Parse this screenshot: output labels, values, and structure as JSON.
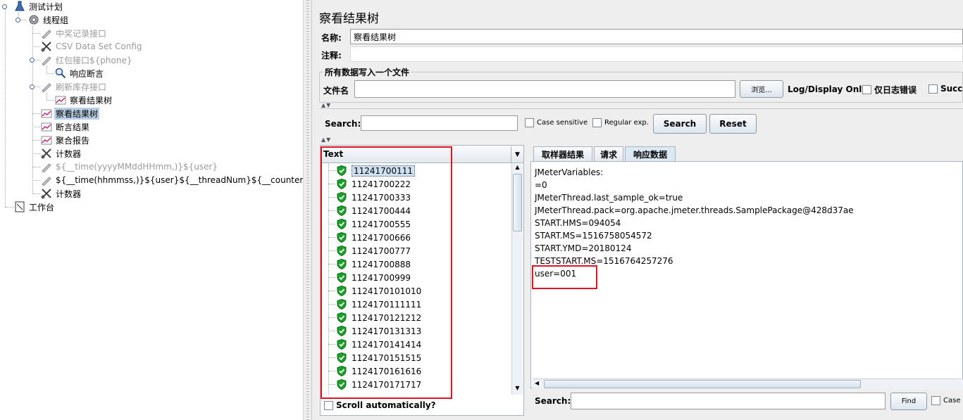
{
  "tree": {
    "items": [
      {
        "label": "测试计划",
        "icon": "test-plan-icon",
        "disabled": false,
        "selected": false
      },
      {
        "label": "线程组",
        "icon": "gear-icon",
        "disabled": false,
        "selected": false
      },
      {
        "label": "中奖记录接口",
        "icon": "sampler-pen-icon",
        "disabled": true,
        "selected": false
      },
      {
        "label": "CSV Data Set Config",
        "icon": "config-scissors-icon",
        "disabled": true,
        "selected": false
      },
      {
        "label": "红包接口${phone}",
        "icon": "sampler-pen-icon",
        "disabled": true,
        "selected": false
      },
      {
        "label": "响应断言",
        "icon": "magnifier-icon",
        "disabled": false,
        "selected": false
      },
      {
        "label": "刷新库存接口",
        "icon": "sampler-pen-icon",
        "disabled": true,
        "selected": false
      },
      {
        "label": "察看结果树",
        "icon": "listener-chart-icon",
        "disabled": false,
        "selected": false
      },
      {
        "label": "察看结果树",
        "icon": "listener-chart-icon",
        "disabled": false,
        "selected": true
      },
      {
        "label": "断言结果",
        "icon": "listener-chart-icon",
        "disabled": false,
        "selected": false
      },
      {
        "label": "聚合报告",
        "icon": "listener-chart-icon",
        "disabled": false,
        "selected": false
      },
      {
        "label": "计数器",
        "icon": "config-scissors-icon",
        "disabled": false,
        "selected": false
      },
      {
        "label": "${__time(yyyyMMddHHmm,)}${user}",
        "icon": "sampler-pen-icon",
        "disabled": true,
        "selected": false
      },
      {
        "label": "${__time(hhmmss,)}${user}${__threadNum}${__counter(,)}",
        "icon": "sampler-pen-icon",
        "disabled": false,
        "selected": false
      },
      {
        "label": "计数器",
        "icon": "config-scissors-icon",
        "disabled": false,
        "selected": false
      },
      {
        "label": "工作台",
        "icon": "workbench-icon",
        "disabled": false,
        "selected": false
      }
    ]
  },
  "panel": {
    "title": "察看结果树",
    "name_label": "名称:",
    "name_value": "察看结果树",
    "comment_label": "注释:",
    "comment_value": "",
    "file_group_title": "所有数据写入一个文件",
    "file_label": "文件名",
    "file_value": "",
    "browse_label": "浏览...",
    "log_display_label": "Log/Display Only:",
    "errors_only_label": "仅日志错误",
    "successes_label": "Succe"
  },
  "search": {
    "label": "Search:",
    "value": "",
    "case_sensitive_label": "Case sensitive",
    "regex_label": "Regular exp.",
    "search_button": "Search",
    "reset_button": "Reset"
  },
  "results": {
    "renderer": "Text",
    "items": [
      "11241700111",
      "11241700222",
      "11241700333",
      "11241700444",
      "11241700555",
      "11241700666",
      "11241700777",
      "11241700888",
      "11241700999",
      "1124170101010",
      "1124170111111",
      "1124170121212",
      "1124170131313",
      "1124170141414",
      "1124170151515",
      "1124170161616",
      "1124170171717"
    ],
    "scroll_auto_label": "Scroll automatically?"
  },
  "tabs": [
    "取样器结果",
    "请求",
    "响应数据"
  ],
  "response": {
    "lines": [
      "JMeterVariables:",
      "=0",
      "JMeterThread.last_sample_ok=true",
      "JMeterThread.pack=org.apache.jmeter.threads.SamplePackage@428d37ae",
      "START.HMS=094054",
      "START.MS=1516758054572",
      "START.YMD=20180124",
      "TESTSTART.MS=1516764257276",
      "user=001"
    ],
    "search_label": "Search:",
    "search_value": "",
    "find_button": "Find",
    "case_label": "Case s"
  },
  "colors": {
    "accent": "#e0141e",
    "selection": "#b8cfe5",
    "success_green": "#1aa12a"
  }
}
